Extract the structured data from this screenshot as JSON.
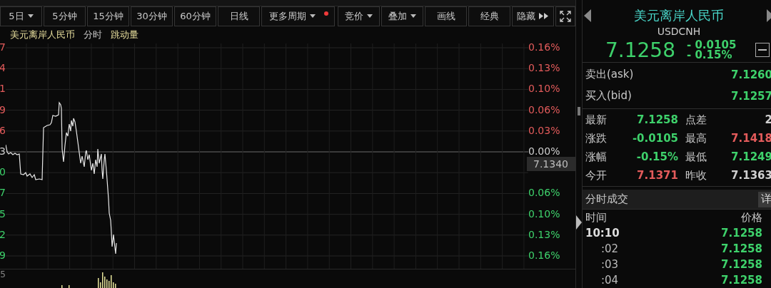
{
  "toolbar": {
    "periods": [
      {
        "label": "5日",
        "kind": "dropdown"
      },
      {
        "label": "5分钟",
        "kind": "plain"
      },
      {
        "label": "15分钟",
        "kind": "plain"
      },
      {
        "label": "30分钟",
        "kind": "plain"
      },
      {
        "label": "60分钟",
        "kind": "plain"
      },
      {
        "label": "日线",
        "kind": "plain"
      },
      {
        "label": "更多周期",
        "kind": "notice"
      }
    ],
    "tools": [
      {
        "label": "竞价",
        "kind": "dropdown"
      },
      {
        "label": "叠加",
        "kind": "dropdown"
      },
      {
        "label": "画线",
        "kind": "plain"
      },
      {
        "label": "经典",
        "kind": "plain"
      },
      {
        "label": "隐藏",
        "kind": "collapse"
      }
    ]
  },
  "chart": {
    "legend": [
      {
        "text": "美元离岸人民币",
        "color": "#e6dd9c"
      },
      {
        "text": "分时",
        "color": "#c8c8c8"
      },
      {
        "text": "跳动量",
        "color": "#e6dd9c"
      }
    ],
    "left_axis": [
      {
        "text": "7",
        "color": "#e35b5b"
      },
      {
        "text": "4",
        "color": "#e35b5b"
      },
      {
        "text": "1",
        "color": "#e35b5b"
      },
      {
        "text": "9",
        "color": "#e35b5b"
      },
      {
        "text": "6",
        "color": "#e35b5b"
      },
      {
        "text": "3",
        "color": "#cfcfcf"
      },
      {
        "text": "0",
        "color": "#3ed16b"
      },
      {
        "text": "7",
        "color": "#3ed16b"
      },
      {
        "text": "5",
        "color": "#3ed16b"
      },
      {
        "text": "2",
        "color": "#3ed16b"
      },
      {
        "text": "9",
        "color": "#3ed16b"
      }
    ],
    "right_axis": [
      {
        "text": "0.16%",
        "color": "#e35b5b"
      },
      {
        "text": "0.13%",
        "color": "#e35b5b"
      },
      {
        "text": "0.10%",
        "color": "#e35b5b"
      },
      {
        "text": "0.06%",
        "color": "#e35b5b"
      },
      {
        "text": "0.03%",
        "color": "#e35b5b"
      },
      {
        "text": "0.00%",
        "color": "#cfcfcf"
      },
      {
        "text": "0.06%",
        "color": "#3ed16b"
      },
      {
        "text": "0.10%",
        "color": "#3ed16b"
      },
      {
        "text": "0.13%",
        "color": "#3ed16b"
      },
      {
        "text": "0.16%",
        "color": "#3ed16b"
      }
    ],
    "price_tag": "7.1340",
    "volume_axis": "5"
  },
  "quote": {
    "name": "美元离岸人民币",
    "code": "USDCNH",
    "price": "7.1258",
    "change": "- 0.0105",
    "change_pct": "- 0.15%",
    "color": "#3ed16b",
    "book": [
      {
        "label": "卖出(ask)",
        "value": "7.1260",
        "color": "#3ed16b"
      },
      {
        "label": "买入(bid)",
        "value": "7.1257",
        "color": "#3ed16b"
      }
    ],
    "stats": [
      {
        "label": "最新",
        "value": "7.1258",
        "color": "#3ed16b"
      },
      {
        "label": "点差",
        "value": "2",
        "color": "#cfcfcf"
      },
      {
        "label": "涨跌",
        "value": "-0.0105",
        "color": "#3ed16b"
      },
      {
        "label": "最高",
        "value": "7.1418",
        "color": "#e35b5b"
      },
      {
        "label": "涨幅",
        "value": "-0.15%",
        "color": "#3ed16b"
      },
      {
        "label": "最低",
        "value": "7.1249",
        "color": "#3ed16b"
      },
      {
        "label": "今开",
        "value": "7.1371",
        "color": "#e35b5b"
      },
      {
        "label": "昨收",
        "value": "7.1363",
        "color": "#cfcfcf"
      }
    ]
  },
  "trades": {
    "title": "分时成交",
    "detail_button": "详",
    "columns": [
      "时间",
      "价格"
    ],
    "rows": [
      {
        "time": "10:10",
        "kind": "full",
        "price": "7.1258",
        "color": "#3ed16b"
      },
      {
        "time": ":02",
        "kind": "minute",
        "price": "7.1258",
        "color": "#3ed16b"
      },
      {
        "time": ":03",
        "kind": "minute",
        "price": "7.1258",
        "color": "#3ed16b"
      },
      {
        "time": ":04",
        "kind": "minute",
        "price": "7.1258",
        "color": "#3ed16b"
      }
    ]
  }
}
